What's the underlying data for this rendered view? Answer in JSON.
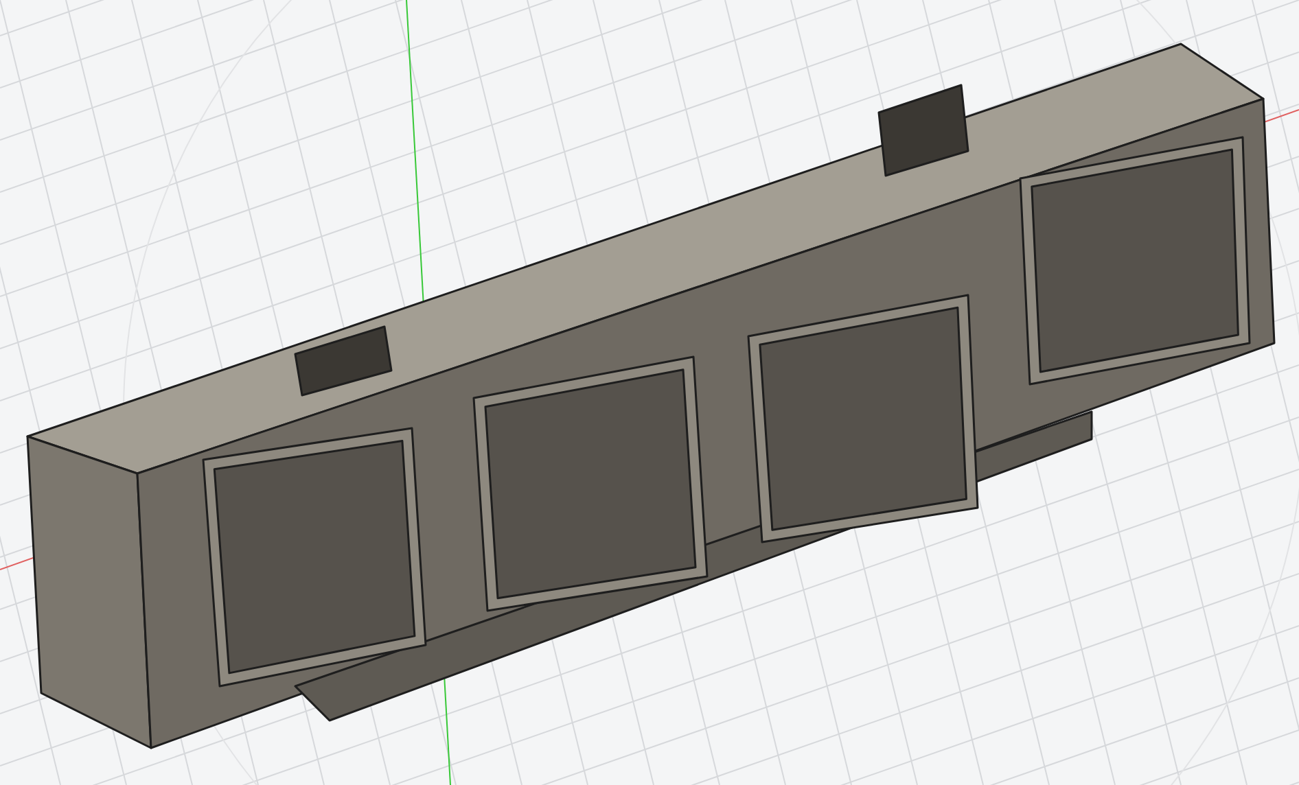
{
  "viewport": {
    "show_grid": true,
    "show_axes": true,
    "model": {
      "kind": "enclosure"
    }
  }
}
